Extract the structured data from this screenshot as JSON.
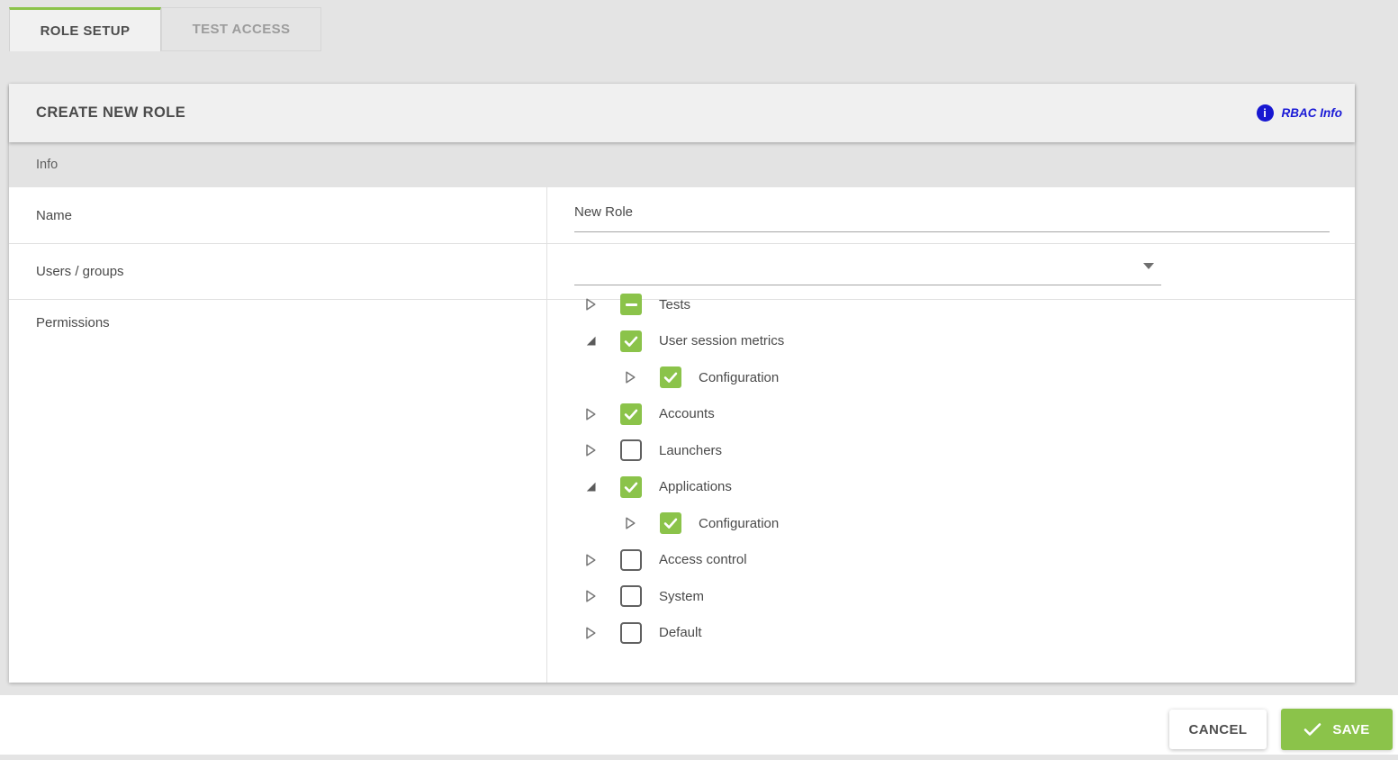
{
  "tabs": [
    {
      "label": "ROLE SETUP",
      "active": true
    },
    {
      "label": "TEST ACCESS",
      "active": false
    }
  ],
  "panel": {
    "title": "CREATE NEW ROLE",
    "rbac_info_label": "RBAC Info",
    "section_label": "Info"
  },
  "form": {
    "name": {
      "label": "Name",
      "value": "New Role"
    },
    "users_groups": {
      "label": "Users / groups",
      "value": ""
    },
    "permissions": {
      "label": "Permissions"
    }
  },
  "permissions_tree": [
    {
      "label": "Tests",
      "state": "indeterminate",
      "expanded": false,
      "level": 0
    },
    {
      "label": "User session metrics",
      "state": "checked",
      "expanded": true,
      "level": 0
    },
    {
      "label": "Configuration",
      "state": "checked",
      "expanded": false,
      "level": 1
    },
    {
      "label": "Accounts",
      "state": "checked",
      "expanded": false,
      "level": 0
    },
    {
      "label": "Launchers",
      "state": "unchecked",
      "expanded": false,
      "level": 0
    },
    {
      "label": "Applications",
      "state": "checked",
      "expanded": true,
      "level": 0
    },
    {
      "label": "Configuration",
      "state": "checked",
      "expanded": false,
      "level": 1
    },
    {
      "label": "Access control",
      "state": "unchecked",
      "expanded": false,
      "level": 0
    },
    {
      "label": "System",
      "state": "unchecked",
      "expanded": false,
      "level": 0
    },
    {
      "label": "Default",
      "state": "unchecked",
      "expanded": false,
      "level": 0
    }
  ],
  "footer": {
    "cancel_label": "CANCEL",
    "save_label": "SAVE"
  },
  "icons": {
    "rbac": "info-icon",
    "tree_collapsed": "expand-arrow-icon",
    "tree_expanded": "collapse-arrow-icon",
    "dropdown": "caret-down-icon",
    "save": "check-icon",
    "checkbox_checked": "checkmark-icon",
    "checkbox_indeterminate": "minus-icon"
  },
  "colors": {
    "accent_green": "#8bc34a",
    "info_blue": "#1a1ad6",
    "page_background": "#e4e4e4"
  }
}
